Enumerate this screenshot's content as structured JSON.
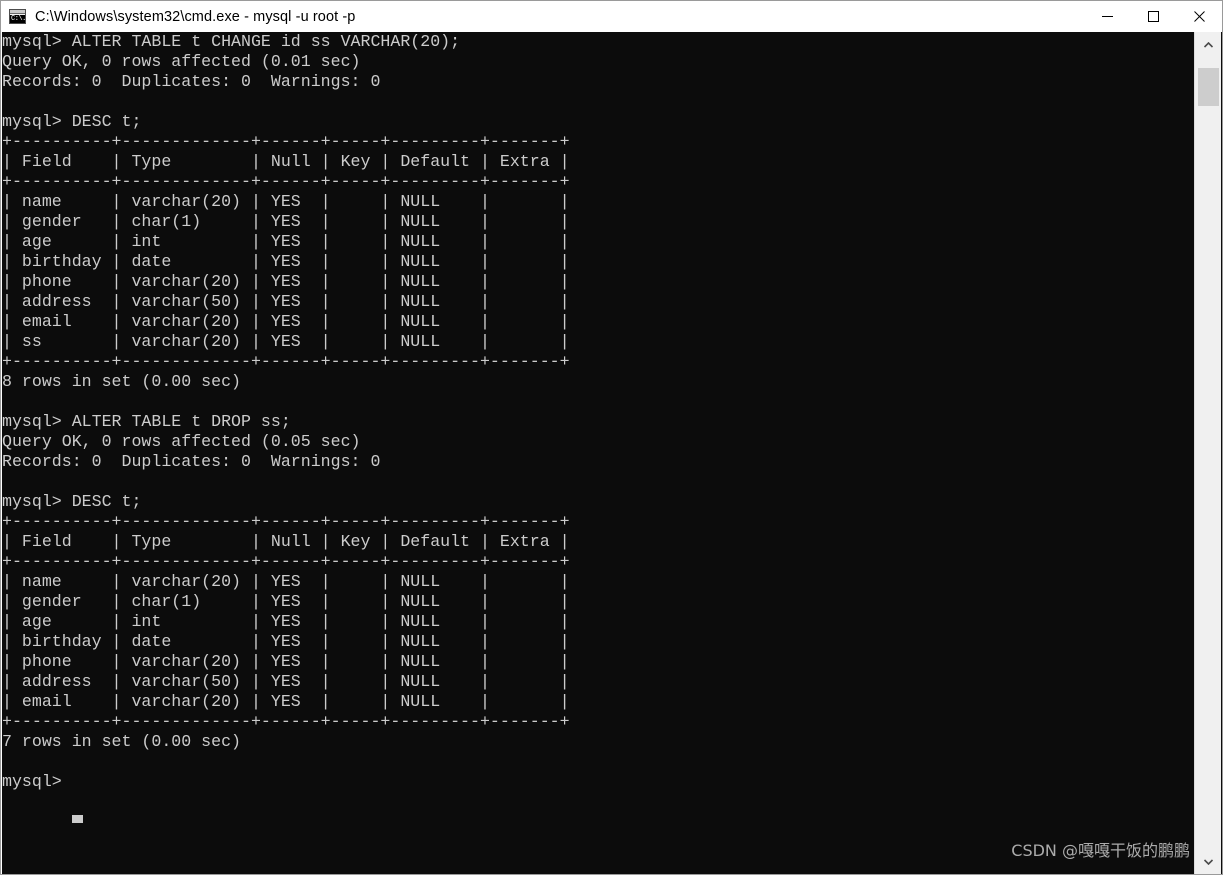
{
  "window": {
    "title": "C:\\Windows\\system32\\cmd.exe - mysql  -u root -p",
    "icon": "cmd-console-icon",
    "icon_glyph": "C:\\.",
    "colors": {
      "console_background": "#0c0c0c",
      "console_foreground": "#cccccc",
      "titlebar_background": "#ffffff",
      "titlebar_foreground": "#000000",
      "scrollbar_track": "#f0f0f0",
      "scrollbar_thumb": "#cdcdcd",
      "watermark_color": "#b9b9b9",
      "close_hover": "#e81123"
    },
    "controls": {
      "minimize": "minimize-button",
      "maximize": "maximize-button",
      "close": "close-button"
    }
  },
  "scrollbar": {
    "up_arrow": "scroll-up-arrow",
    "down_arrow": "scroll-down-arrow",
    "thumb": "scrollbar-thumb"
  },
  "console": {
    "prompt": "mysql>",
    "cursor": "block",
    "content": "mysql> ALTER TABLE t CHANGE id ss VARCHAR(20);\nQuery OK, 0 rows affected (0.01 sec)\nRecords: 0  Duplicates: 0  Warnings: 0\n\nmysql> DESC t;\n+----------+-------------+------+-----+---------+-------+\n| Field    | Type        | Null | Key | Default | Extra |\n+----------+-------------+------+-----+---------+-------+\n| name     | varchar(20) | YES  |     | NULL    |       |\n| gender   | char(1)     | YES  |     | NULL    |       |\n| age      | int         | YES  |     | NULL    |       |\n| birthday | date        | YES  |     | NULL    |       |\n| phone    | varchar(20) | YES  |     | NULL    |       |\n| address  | varchar(50) | YES  |     | NULL    |       |\n| email    | varchar(20) | YES  |     | NULL    |       |\n| ss       | varchar(20) | YES  |     | NULL    |       |\n+----------+-------------+------+-----+---------+-------+\n8 rows in set (0.00 sec)\n\nmysql> ALTER TABLE t DROP ss;\nQuery OK, 0 rows affected (0.05 sec)\nRecords: 0  Duplicates: 0  Warnings: 0\n\nmysql> DESC t;\n+----------+-------------+------+-----+---------+-------+\n| Field    | Type        | Null | Key | Default | Extra |\n+----------+-------------+------+-----+---------+-------+\n| name     | varchar(20) | YES  |     | NULL    |       |\n| gender   | char(1)     | YES  |     | NULL    |       |\n| age      | int         | YES  |     | NULL    |       |\n| birthday | date        | YES  |     | NULL    |       |\n| phone    | varchar(20) | YES  |     | NULL    |       |\n| address  | varchar(50) | YES  |     | NULL    |       |\n| email    | varchar(20) | YES  |     | NULL    |       |\n+----------+-------------+------+-----+---------+-------+\n7 rows in set (0.00 sec)\n\nmysql>",
    "commands": [
      "ALTER TABLE t CHANGE id ss VARCHAR(20);",
      "DESC t;",
      "ALTER TABLE t DROP ss;",
      "DESC t;"
    ],
    "results": [
      {
        "type": "status",
        "lines": [
          "Query OK, 0 rows affected (0.01 sec)",
          "Records: 0  Duplicates: 0  Warnings: 0"
        ]
      },
      {
        "type": "table",
        "columns": [
          "Field",
          "Type",
          "Null",
          "Key",
          "Default",
          "Extra"
        ],
        "rows": [
          [
            "name",
            "varchar(20)",
            "YES",
            "",
            "NULL",
            ""
          ],
          [
            "gender",
            "char(1)",
            "YES",
            "",
            "NULL",
            ""
          ],
          [
            "age",
            "int",
            "YES",
            "",
            "NULL",
            ""
          ],
          [
            "birthday",
            "date",
            "YES",
            "",
            "NULL",
            ""
          ],
          [
            "phone",
            "varchar(20)",
            "YES",
            "",
            "NULL",
            ""
          ],
          [
            "address",
            "varchar(50)",
            "YES",
            "",
            "NULL",
            ""
          ],
          [
            "email",
            "varchar(20)",
            "YES",
            "",
            "NULL",
            ""
          ],
          [
            "ss",
            "varchar(20)",
            "YES",
            "",
            "NULL",
            ""
          ]
        ],
        "footer": "8 rows in set (0.00 sec)"
      },
      {
        "type": "status",
        "lines": [
          "Query OK, 0 rows affected (0.05 sec)",
          "Records: 0  Duplicates: 0  Warnings: 0"
        ]
      },
      {
        "type": "table",
        "columns": [
          "Field",
          "Type",
          "Null",
          "Key",
          "Default",
          "Extra"
        ],
        "rows": [
          [
            "name",
            "varchar(20)",
            "YES",
            "",
            "NULL",
            ""
          ],
          [
            "gender",
            "char(1)",
            "YES",
            "",
            "NULL",
            ""
          ],
          [
            "age",
            "int",
            "YES",
            "",
            "NULL",
            ""
          ],
          [
            "birthday",
            "date",
            "YES",
            "",
            "NULL",
            ""
          ],
          [
            "phone",
            "varchar(20)",
            "YES",
            "",
            "NULL",
            ""
          ],
          [
            "address",
            "varchar(50)",
            "YES",
            "",
            "NULL",
            ""
          ],
          [
            "email",
            "varchar(20)",
            "YES",
            "",
            "NULL",
            ""
          ]
        ],
        "footer": "7 rows in set (0.00 sec)"
      }
    ]
  },
  "watermark": {
    "text": "CSDN @嘎嘎干饭的鹏鹏"
  }
}
